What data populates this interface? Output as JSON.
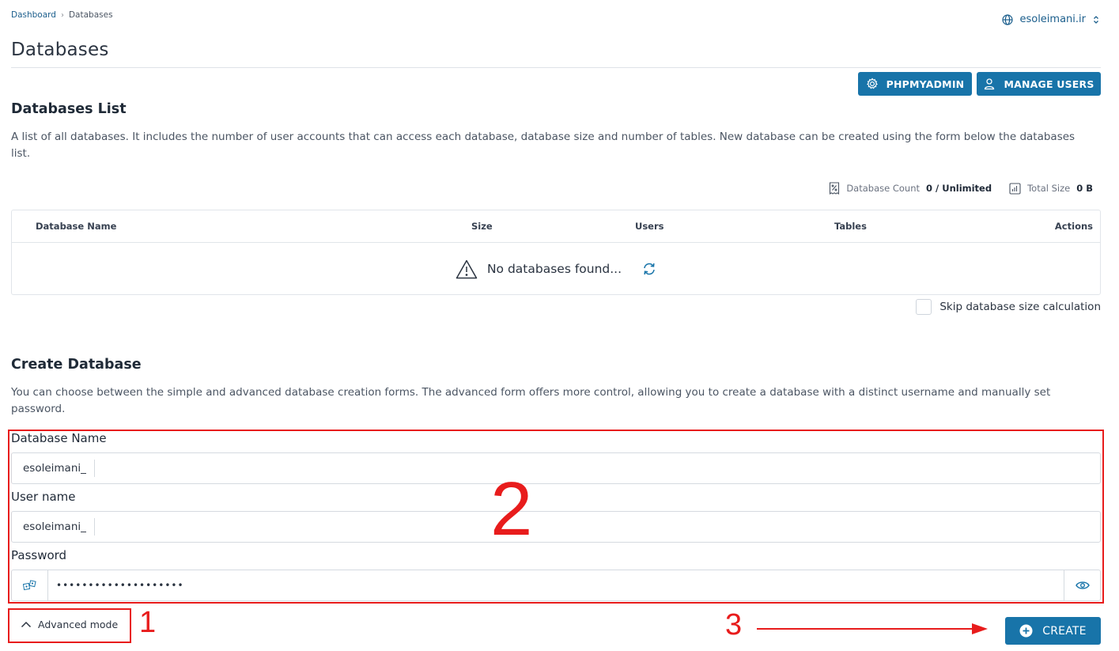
{
  "breadcrumb": {
    "root": "Dashboard",
    "separator": "›",
    "current": "Databases"
  },
  "user_switcher": {
    "username": "esoleimani.ir"
  },
  "page": {
    "title": "Databases"
  },
  "toolbar": {
    "phpmyadmin_label": "PHPMYADMIN",
    "manage_users_label": "MANAGE USERS"
  },
  "list_section": {
    "title": "Databases List",
    "description": "A list of all databases. It includes the number of user accounts that can access each database, database size and number of tables. New database can be created using the form below the databases list."
  },
  "stats": {
    "count_label": "Database Count",
    "count_value": "0 / Unlimited",
    "size_label": "Total Size",
    "size_value": "0 B"
  },
  "table": {
    "columns": [
      "Database Name",
      "Size",
      "Users",
      "Tables",
      "Actions"
    ],
    "empty_message": "No databases found..."
  },
  "skip_size": {
    "label": "Skip database size calculation",
    "checked": false
  },
  "create_section": {
    "title": "Create Database",
    "description": "You can choose between the simple and advanced database creation forms. The advanced form offers more control, allowing you to create a database with a distinct username and manually set password."
  },
  "form": {
    "db_name": {
      "label": "Database Name",
      "prefix": "esoleimani_",
      "value": ""
    },
    "user_name": {
      "label": "User name",
      "prefix": "esoleimani_",
      "value": ""
    },
    "password": {
      "label": "Password",
      "masked_value": "••••••••••••••••••••"
    }
  },
  "advanced_mode": {
    "label": "Advanced mode"
  },
  "create_button": {
    "label": "CREATE"
  },
  "annotations": {
    "n1": "1",
    "n2": "2",
    "n3": "3"
  },
  "colors": {
    "accent": "#1874a9",
    "link": "#1b5e8c",
    "annotation": "#e81c1c"
  },
  "icons": {
    "globe": "globe-icon",
    "updown": "chevron-updown-icon",
    "gear": "gear-icon",
    "user": "user-icon",
    "db_count": "database-count-icon",
    "size": "chart-icon",
    "warning": "warning-icon",
    "refresh": "refresh-icon",
    "generate": "password-generate-icon",
    "eye": "eye-icon",
    "chevron_up": "chevron-up-icon",
    "plus": "plus-circle-icon"
  }
}
